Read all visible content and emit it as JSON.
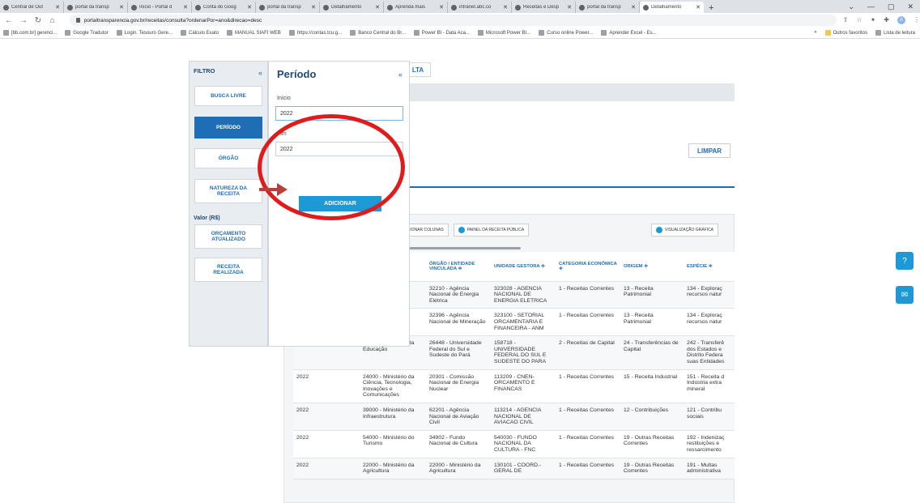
{
  "browser": {
    "tabs": [
      {
        "title": "Central de Out"
      },
      {
        "title": "portal da transp"
      },
      {
        "title": "Início - Portal d"
      },
      {
        "title": "Conta do Goog"
      },
      {
        "title": "portal da transp"
      },
      {
        "title": "Detalhamento"
      },
      {
        "title": "Aprenda mais"
      },
      {
        "title": "intranet.abc.co"
      },
      {
        "title": "Receitas e Desp"
      },
      {
        "title": "portal da transp"
      },
      {
        "title": "Detalhamento"
      }
    ],
    "url": "portaltransparencia.gov.br/receitas/consulta?ordenarPor=ano&direcao=desc",
    "avatar_letter": "A",
    "bookmarks": [
      "[bb.com.br] gerenci...",
      "Google Tradutor",
      "Login. Tesouro Gere...",
      "Cálculo Exato",
      "MANUAL SIAFI WEB",
      "https://contas.tcu.g...",
      "Banco Central do Br...",
      "Power BI - Data Aca...",
      "Microsoft Power BI...",
      "Curso online Power...",
      "Aprender Excel - Es..."
    ],
    "bookmarks_right": [
      "»",
      "Outros favoritos",
      "Lista de leitura"
    ]
  },
  "page": {
    "consulta_label": "LTA",
    "limpar_label": "LIMPAR",
    "toolbar_buttons": [
      "ER/ADICIONAR COLUNAS",
      "PAINEL DA RECEITA PÚBLICA"
    ],
    "viz_label": "VISUALIZAÇÃO GRÁFICA"
  },
  "filtro": {
    "title": "FILTRO",
    "collapse": "«",
    "buttons": [
      "BUSCA LIVRE",
      "PERÍODO",
      "ÓRGÃO",
      "NATUREZA DA RECEITA"
    ],
    "valor_label": "Valor (R$)",
    "valor_buttons": [
      "ORÇAMENTO ATUALIZADO",
      "RECEITA REALIZADA"
    ]
  },
  "periodo": {
    "title": "Período",
    "collapse": "«",
    "inicio_label": "Início",
    "inicio_value": "2022",
    "fim_label": "Fim",
    "fim_value": "2022",
    "add_button": "ADICIONAR"
  },
  "table": {
    "headers": [
      "",
      "",
      "ÓRGÃO / ENTIDADE VINCULADA ≑",
      "UNIDADE GESTORA ≑",
      "CATEGORIA ECONÔMICA ≑",
      "ORIGEM ≑",
      "ESPÉCIE ≑"
    ],
    "rows": [
      [
        "",
        "a",
        "32210 - Agência Nacional de Energia Elétrica",
        "323028 - AGENCIA NACIONAL DE ENERGIA ELETRICA",
        "1 - Receitas Correntes",
        "13 - Receita Patrimonial",
        "134 - Exploraç recursos natur"
      ],
      [
        "",
        "a",
        "32396 - Agência Nacional de Mineração",
        "323100 - SETORIAL ORCAMENTARIA E FINANCEIRA - ANM",
        "1 - Receitas Correntes",
        "13 - Receita Patrimonial",
        "134 - Exploraç recursos natur"
      ],
      [
        "2022",
        "26000 - Ministério da Educação",
        "26448 - Universidade Federal do Sul e Sudeste do Pará",
        "158718 - UNIVERSIDADE FEDERAL DO SUL E SUDESTE DO PARA",
        "2 - Receitas de Capital",
        "24 - Transferências de Capital",
        "242 - Transferê dos Estados e Distrito Federa suas Entidades"
      ],
      [
        "2022",
        "24000 - Ministério da Ciência, Tecnologia, Inovações e Comunicações",
        "20301 - Comissão Nacional de Energia Nuclear",
        "113209 - CNEN-ORCAMENTO E FINANCAS",
        "1 - Receitas Correntes",
        "15 - Receita Industrial",
        "151 - Receita d Indústria extra mineral"
      ],
      [
        "2022",
        "39000 - Ministério da Infraestrutura",
        "62201 - Agência Nacional de Aviação Civil",
        "113214 - AGENCIA NACIONAL DE AVIACAO CIVIL",
        "1 - Receitas Correntes",
        "12 - Contribuições",
        "121 - Contribu sociais"
      ],
      [
        "2022",
        "54000 - Ministério do Turismo",
        "34902 - Fundo Nacional de Cultura",
        "540030 - FUNDO NACIONAL DA CULTURA - FNC",
        "1 - Receitas Correntes",
        "19 - Outras Receitas Correntes",
        "192 - Indenizaç restituições e ressarcimento"
      ],
      [
        "2022",
        "22000 - Ministério da Agricultura",
        "22000 - Ministério da Agricultura",
        "130101 - COORD.-GERAL DE",
        "1 - Receitas Correntes",
        "19 - Outras Receitas Correntes",
        "191 - Multas administrativa"
      ]
    ]
  },
  "side_buttons": [
    {
      "icon": "help-icon",
      "glyph": "?"
    },
    {
      "icon": "mail-icon",
      "glyph": "✉"
    }
  ],
  "colors": {
    "accent": "#1f6db5",
    "button_blue": "#1d9ad6",
    "annotation_red": "#e01b1b"
  }
}
